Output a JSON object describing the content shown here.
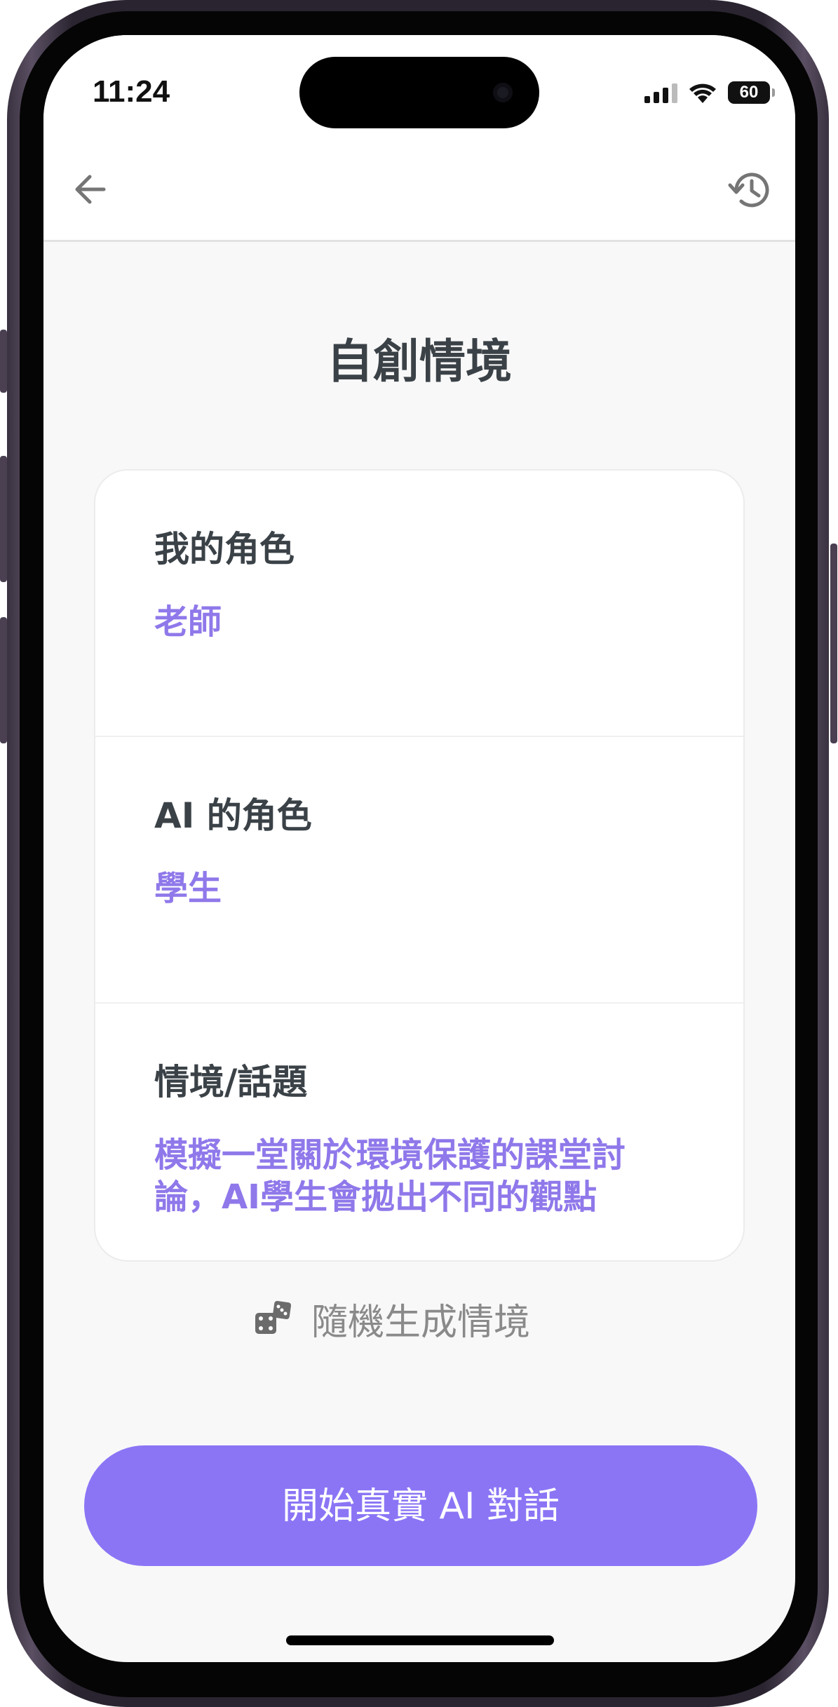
{
  "status_bar": {
    "time": "11:24",
    "battery": "60",
    "signal_icon": "cellular-signal-icon",
    "wifi_icon": "wifi-icon",
    "battery_icon": "battery-icon"
  },
  "nav": {
    "back_icon": "arrow-left-icon",
    "history_icon": "history-icon"
  },
  "page": {
    "title": "自創情境"
  },
  "card": {
    "sections": [
      {
        "label": "我的角色",
        "value": "老師"
      },
      {
        "label": "AI 的角色",
        "value": "學生"
      },
      {
        "label": "情境/話題",
        "value": "模擬一堂關於環境保護的課堂討論，AI學生會拋出不同的觀點"
      }
    ]
  },
  "random": {
    "icon": "dice-icon",
    "label": "隨機生成情境"
  },
  "cta": {
    "label": "開始真實 AI 對話"
  },
  "colors": {
    "accent": "#8B75F5",
    "value_text": "#8F78EA",
    "heading": "#3B4247",
    "muted": "#8A8A8A",
    "background": "#F8F8F8"
  }
}
